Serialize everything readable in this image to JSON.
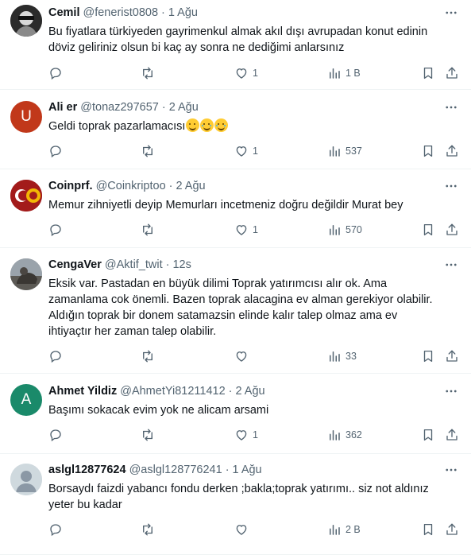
{
  "tweets": [
    {
      "name": "Cemil",
      "handle": "@fenerist0808",
      "sep": "·",
      "time": "1 Ağu",
      "text": "Bu fiyatlara türkiyeden gayrimenkul almak akıl dışı avrupadan konut edinin\ndöviz geliriniz olsun bi kaç ay sonra ne dediğimi anlarsınız",
      "emoji": [],
      "likes": "1",
      "views": "1 B",
      "avatar": "photo-bw",
      "avatar_color": "#3a3a3a"
    },
    {
      "name": "Ali er",
      "handle": "@tonaz297657",
      "sep": "·",
      "time": "2 Ağu",
      "text": "Geldi toprak pazarlamacısı",
      "emoji": [
        "wink-face",
        "joy-face",
        "joy-face"
      ],
      "likes": "1",
      "views": "537",
      "avatar": "letter",
      "avatar_letter": "U",
      "avatar_color": "#c1381a"
    },
    {
      "name": "Coinprf.",
      "handle": "@Coinkriptoo",
      "sep": "·",
      "time": "2 Ağu",
      "text": "Memur zihniyetli deyip Memurları incetmeniz doğru değildir Murat bey",
      "emoji": [],
      "likes": "1",
      "views": "570",
      "avatar": "flag-logo",
      "avatar_color": "#8b1a1a"
    },
    {
      "name": "CengaVer",
      "handle": "@Aktif_twit",
      "sep": "·",
      "time": "12s",
      "text": "Eksik var. Pastadan en büyük dilimi Toprak yatırımcısı alır ok. Ama\nzamanlama cok önemli. Bazen toprak alacagina ev alman gerekiyor olabilir.\nAldığın toprak bir donem satamazsin elinde kalır talep olmaz ama ev\nihtiyaçtır her zaman talep olabilir.",
      "emoji": [],
      "likes": "",
      "views": "33",
      "avatar": "photo-statue",
      "avatar_color": "#6b6f74"
    },
    {
      "name": "Ahmet Yildiz",
      "handle": "@AhmetYi81211412",
      "sep": "·",
      "time": "2 Ağu",
      "text": "Başımı sokacak evim yok ne alicam arsami",
      "emoji": [],
      "likes": "1",
      "views": "362",
      "avatar": "letter",
      "avatar_letter": "A",
      "avatar_color": "#1a8a6a"
    },
    {
      "name": "aslgl12877624",
      "handle": "@aslgl128776241",
      "sep": "·",
      "time": "1 Ağu",
      "text": "Borsaydı faizdi yabancı fondu derken ;bakla;toprak yatırımı.. siz not aldınız\nyeter bu kadar",
      "emoji": [],
      "likes": "",
      "views": "2 B",
      "avatar": "default-person",
      "avatar_color": "#cfd9de"
    }
  ],
  "icons": {
    "more": "more-horizontal-icon",
    "reply": "reply-icon",
    "retweet": "retweet-icon",
    "like": "heart-icon",
    "views": "views-chart-icon",
    "bookmark": "bookmark-icon",
    "share": "share-icon"
  },
  "colors": {
    "text": "#0f1419",
    "secondary": "#536471",
    "divider": "#eff3f4"
  }
}
